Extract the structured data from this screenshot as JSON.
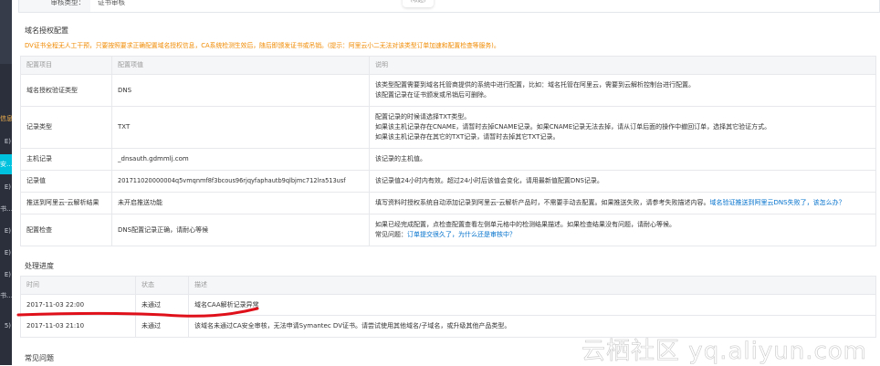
{
  "sidebar": {
    "items": [
      {
        "label": "信息…",
        "state": "warn"
      },
      {
        "label": "E)",
        "state": ""
      },
      {
        "label": "安…",
        "state": "active"
      },
      {
        "label": "E)",
        "state": ""
      },
      {
        "label": "书…",
        "state": ""
      },
      {
        "label": "E)",
        "state": ""
      },
      {
        "label": "E)",
        "state": ""
      },
      {
        "label": "E)",
        "state": ""
      },
      {
        "label": "书…",
        "state": ""
      },
      {
        "label": "5)",
        "state": ""
      }
    ]
  },
  "top_card": {
    "label": "审核类型：",
    "value": "证书审核",
    "button_label": "(收起)"
  },
  "domain_config": {
    "title": "域名授权配置",
    "note": "DV证书全程无人工干预，只要按照要求正确配置域名授权信息，CA系统检测生效后，随后即颁发证书或吊销。(提示：阿里云小二无法对该类型订单加速和配置检查等服务)。",
    "headers": [
      "配置项目",
      "配置项值",
      "说明"
    ],
    "rows": [
      {
        "item": "域名授权验证类型",
        "value": "DNS",
        "desc": [
          "该类型配置需要到域名托管商提供的系统中进行配置，比如：域名托管在阿里云，需要到云解析控制台进行配置。",
          "该配置记录在证书颁发或吊销后可删除。"
        ]
      },
      {
        "item": "记录类型",
        "value": "TXT",
        "desc": [
          "配置记录的时候请选择TXT类型。",
          "如果该主机记录存在CNAME，请暂时去掉CNAME记录。如果CNAME记录无法去掉，请从订单后面的操作中撤回订单，选择其它验证方式。",
          "如果该主机记录存在其它的TXT记录，请暂时去掉其它TXT记录。"
        ]
      },
      {
        "item": "主机记录",
        "value": "_dnsauth.gdmmlj.com",
        "desc": [
          "该记录的主机值。"
        ]
      },
      {
        "item": "记录值",
        "value": "201711020000004q5vmqnmf8f3bcous96rjqyfaphautb9qlbjmc712lra513usf",
        "desc": [
          "该记录值24小时内有效。超过24小时后该值会变化，请用最新值配置DNS记录。"
        ]
      },
      {
        "item": "推送到阿里云-云解析结果",
        "value": "未开启推送功能",
        "desc": [
          "填写资料时授权系统自动添加记录到阿里云-云解析产品时，不需要手动去配置。如果推送失败，请参考失败描述内容。"
        ],
        "link": "域名验证推送到阿里云DNS失败了，该怎么办？"
      },
      {
        "item": "配置检查",
        "value": "DNS配置记录正确，请耐心等候",
        "desc": [
          "如果已经完成配置，点检查配置查看左侧单元格中的检测结果描述。如果检查结果没有问题，请耐心等候。"
        ],
        "faq_prefix": "常见问题：",
        "faq_link": "订单提交很久了，为什么还是审核中？"
      }
    ]
  },
  "progress": {
    "title": "处理进度",
    "headers": [
      "时间",
      "状态",
      "描述"
    ],
    "rows": [
      {
        "time": "2017-11-03 22:00",
        "status": "未通过",
        "desc": "域名CAA解析记录异常"
      },
      {
        "time": "2017-11-03 21:10",
        "status": "未通过",
        "desc": "该域名未通过CA安全审核，无法申请Symantec DV证书。请尝试使用其他域名/子域名，或升级其他产品类型。"
      }
    ]
  },
  "faq_title": "常见问题",
  "watermark": "云栖社区 yq.aliyun.com",
  "colors": {
    "accent": "#00c1de",
    "warning": "#f08a00",
    "link": "#0070cc",
    "annotation": "#e0101a"
  }
}
